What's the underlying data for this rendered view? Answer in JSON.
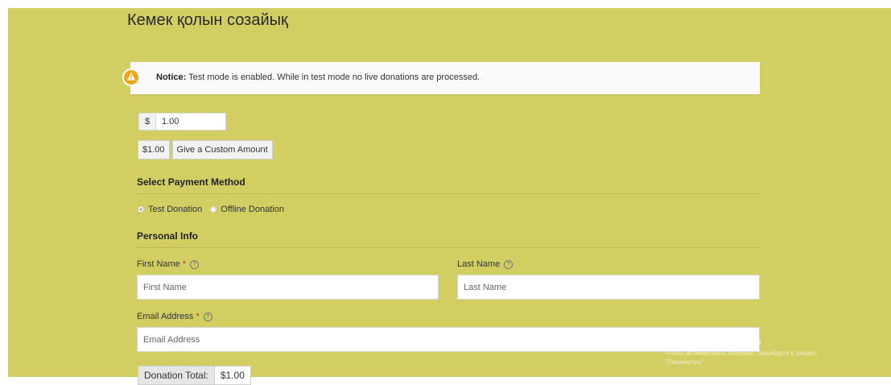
{
  "page_title": "Кемек қолын созайық",
  "notice": {
    "label": "Notice:",
    "text": " Test mode is enabled. While in test mode no live donations are processed."
  },
  "amount": {
    "currency": "$",
    "value": "1.00"
  },
  "levels": {
    "preset_label": "$1.00",
    "custom_label": "Give a Custom Amount"
  },
  "payment": {
    "title": "Select Payment Method",
    "options": [
      {
        "label": "Test Donation",
        "selected": true
      },
      {
        "label": "Offline Donation",
        "selected": false
      }
    ]
  },
  "personal": {
    "title": "Personal Info",
    "first_name": {
      "label": "First Name",
      "placeholder": "First Name"
    },
    "last_name": {
      "label": "Last Name",
      "placeholder": "Last Name"
    },
    "email": {
      "label": "Email Address",
      "placeholder": "Email Address"
    },
    "required_mark": "*",
    "help_glyph": "?"
  },
  "total": {
    "label": "Donation Total:",
    "amount": "$1.00"
  },
  "watermark": {
    "line1": "Активация Windows",
    "line2": "Чтобы активировать Windows, перейдите в раздел",
    "line3": "\"Параметры\"."
  },
  "colors": {
    "background": "#d2cf62",
    "notice_icon": "#f0a619"
  }
}
